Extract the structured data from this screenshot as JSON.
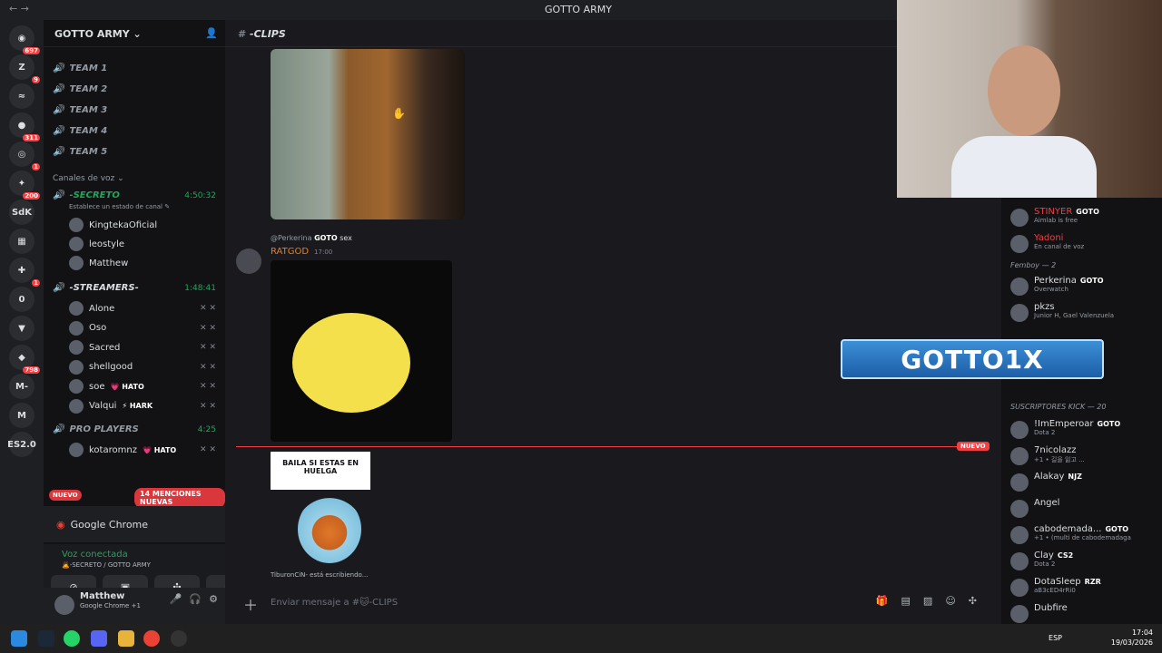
{
  "titlebar": {
    "title": "GOTTO ARMY",
    "nav": "←  →"
  },
  "servers": [
    {
      "label": "◉",
      "badge": "697"
    },
    {
      "label": "Z",
      "badge": "9"
    },
    {
      "label": "≈",
      "badge": ""
    },
    {
      "label": "●",
      "badge": "311"
    },
    {
      "label": "◎",
      "badge": "1"
    },
    {
      "label": "✦",
      "badge": "200"
    },
    {
      "label": "SdK",
      "badge": ""
    },
    {
      "label": "▦",
      "badge": ""
    },
    {
      "label": "✚",
      "badge": "1"
    },
    {
      "label": "0",
      "badge": ""
    },
    {
      "label": "▼",
      "badge": ""
    },
    {
      "label": "◆",
      "badge": "798"
    },
    {
      "label": "M-",
      "badge": ""
    },
    {
      "label": "M",
      "badge": ""
    },
    {
      "label": "ES2.0",
      "badge": ""
    }
  ],
  "guild": {
    "name": "GOTTO ARMY ⌄"
  },
  "voice_channels": [
    {
      "name": "TEAM 1"
    },
    {
      "name": "TEAM 2"
    },
    {
      "name": "TEAM 3"
    },
    {
      "name": "TEAM 4"
    },
    {
      "name": "TEAM 5"
    }
  ],
  "voice_section": "Canales de voz ⌄",
  "secreto": {
    "name": "-SECRETO",
    "time": "4:50:32",
    "status": "Establece un estado de canal ✎"
  },
  "secreto_users": [
    "KingtekaOficial",
    "leostyle",
    "Matthew"
  ],
  "streamers": {
    "name": "-STREAMERS-",
    "time": "1:48:41"
  },
  "streamer_users": [
    {
      "name": "Alone",
      "tag": ""
    },
    {
      "name": "Oso",
      "tag": ""
    },
    {
      "name": "Sacred",
      "tag": ""
    },
    {
      "name": "shellgood",
      "tag": ""
    },
    {
      "name": "soe",
      "tag": "💗 HATO"
    },
    {
      "name": "Valqui",
      "tag": "⚡ HARK"
    }
  ],
  "pro": {
    "name": "PRO PLAYERS",
    "time": "4:25"
  },
  "pro_users": [
    {
      "name": "kotaromnz",
      "tag": "💗 HATO"
    }
  ],
  "mentions": "14 MENCIONES NUEVAS",
  "nuevo_left": "NUEVO",
  "chrome": {
    "label": "Google Chrome"
  },
  "voice": {
    "connected": "Voz conectada",
    "sub": "🙇-SECRETO / GOTTO ARMY"
  },
  "me": {
    "name": "Matthew",
    "status": "Google Chrome +1"
  },
  "channel": {
    "name": "-CLIPS"
  },
  "messages": {
    "reply_user": "@Perkerina",
    "reply_tag": "GOTO",
    "reply_text": "sex",
    "author": "RATGOD",
    "time": "17:00",
    "new_tag": "NUEVO",
    "sticker": "BAILA SI ESTAS EN HUELGA",
    "typing": "TiburonCiN- está escribiendo..."
  },
  "input": {
    "placeholder": "Enviar mensaje a #🐱-CLIPS"
  },
  "banner": "GOTTO1X",
  "members": {
    "top": [
      {
        "name": "STINYER",
        "tag": "GOTO",
        "sub": "Aimlab is free",
        "color": "#f23f42"
      },
      {
        "name": "Yadoni",
        "tag": "",
        "sub": "En canal de voz",
        "color": "#f23f42"
      }
    ],
    "femboy": "Femboy — 2",
    "femboy_list": [
      {
        "name": "Perkerina",
        "tag": "GOTO",
        "sub": "Overwatch",
        "color": "#dbdee1"
      },
      {
        "name": "pkzs",
        "tag": "",
        "sub": "Junior H, Gael Valenzuela",
        "color": "#dbdee1"
      }
    ],
    "kick": "SUSCRIPTORES KICK — 20",
    "kick_list": [
      {
        "name": "!ImEmperoar",
        "tag": "GOTO",
        "sub": "Dota 2",
        "color": "#dbdee1"
      },
      {
        "name": "7nicolazz",
        "tag": "",
        "sub": "+1 • 길을 잃고 ...",
        "color": "#dbdee1"
      },
      {
        "name": "Alakay",
        "tag": "NJZ",
        "sub": "",
        "color": "#dbdee1"
      },
      {
        "name": "Angel",
        "tag": "",
        "sub": "",
        "color": "#dbdee1"
      },
      {
        "name": "cabodemada...",
        "tag": "GOTO",
        "sub": "+1 • (multi de cabodemadaga",
        "color": "#dbdee1"
      },
      {
        "name": "Clay",
        "tag": "CS2",
        "sub": "Dota 2",
        "color": "#dbdee1"
      },
      {
        "name": "DotaSleep",
        "tag": "RZR",
        "sub": "aB3cED4rRi0",
        "color": "#dbdee1"
      },
      {
        "name": "Dubfire",
        "tag": "",
        "sub": "",
        "color": "#dbdee1"
      }
    ]
  },
  "tray": {
    "lang": "ESP",
    "time": "17:04",
    "date": "19/03/2026"
  }
}
